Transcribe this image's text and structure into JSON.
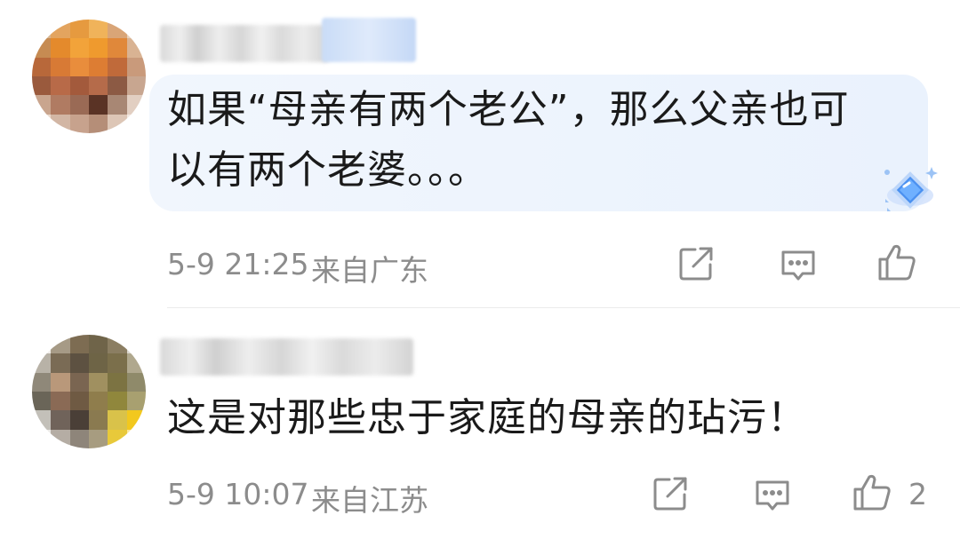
{
  "comments": [
    {
      "text": "如果“母亲有两个老公”，那么父亲也可以有两个老婆。。。",
      "time": "5-9 21:25",
      "location": "来自广东",
      "like_count": ""
    },
    {
      "text": "这是对那些忠于家庭的母亲的玷污！",
      "time": "5-9 10:07",
      "location": "来自江苏",
      "like_count": "2"
    }
  ],
  "icons": {
    "share": "share-icon",
    "comment": "comment-icon",
    "like": "like-icon",
    "badge": "diamond-badge-icon"
  },
  "colors": {
    "bubble": "#eef4fd",
    "text": "#1a1a1a",
    "meta": "#8c8c8c",
    "badge": "#4a90f0"
  }
}
